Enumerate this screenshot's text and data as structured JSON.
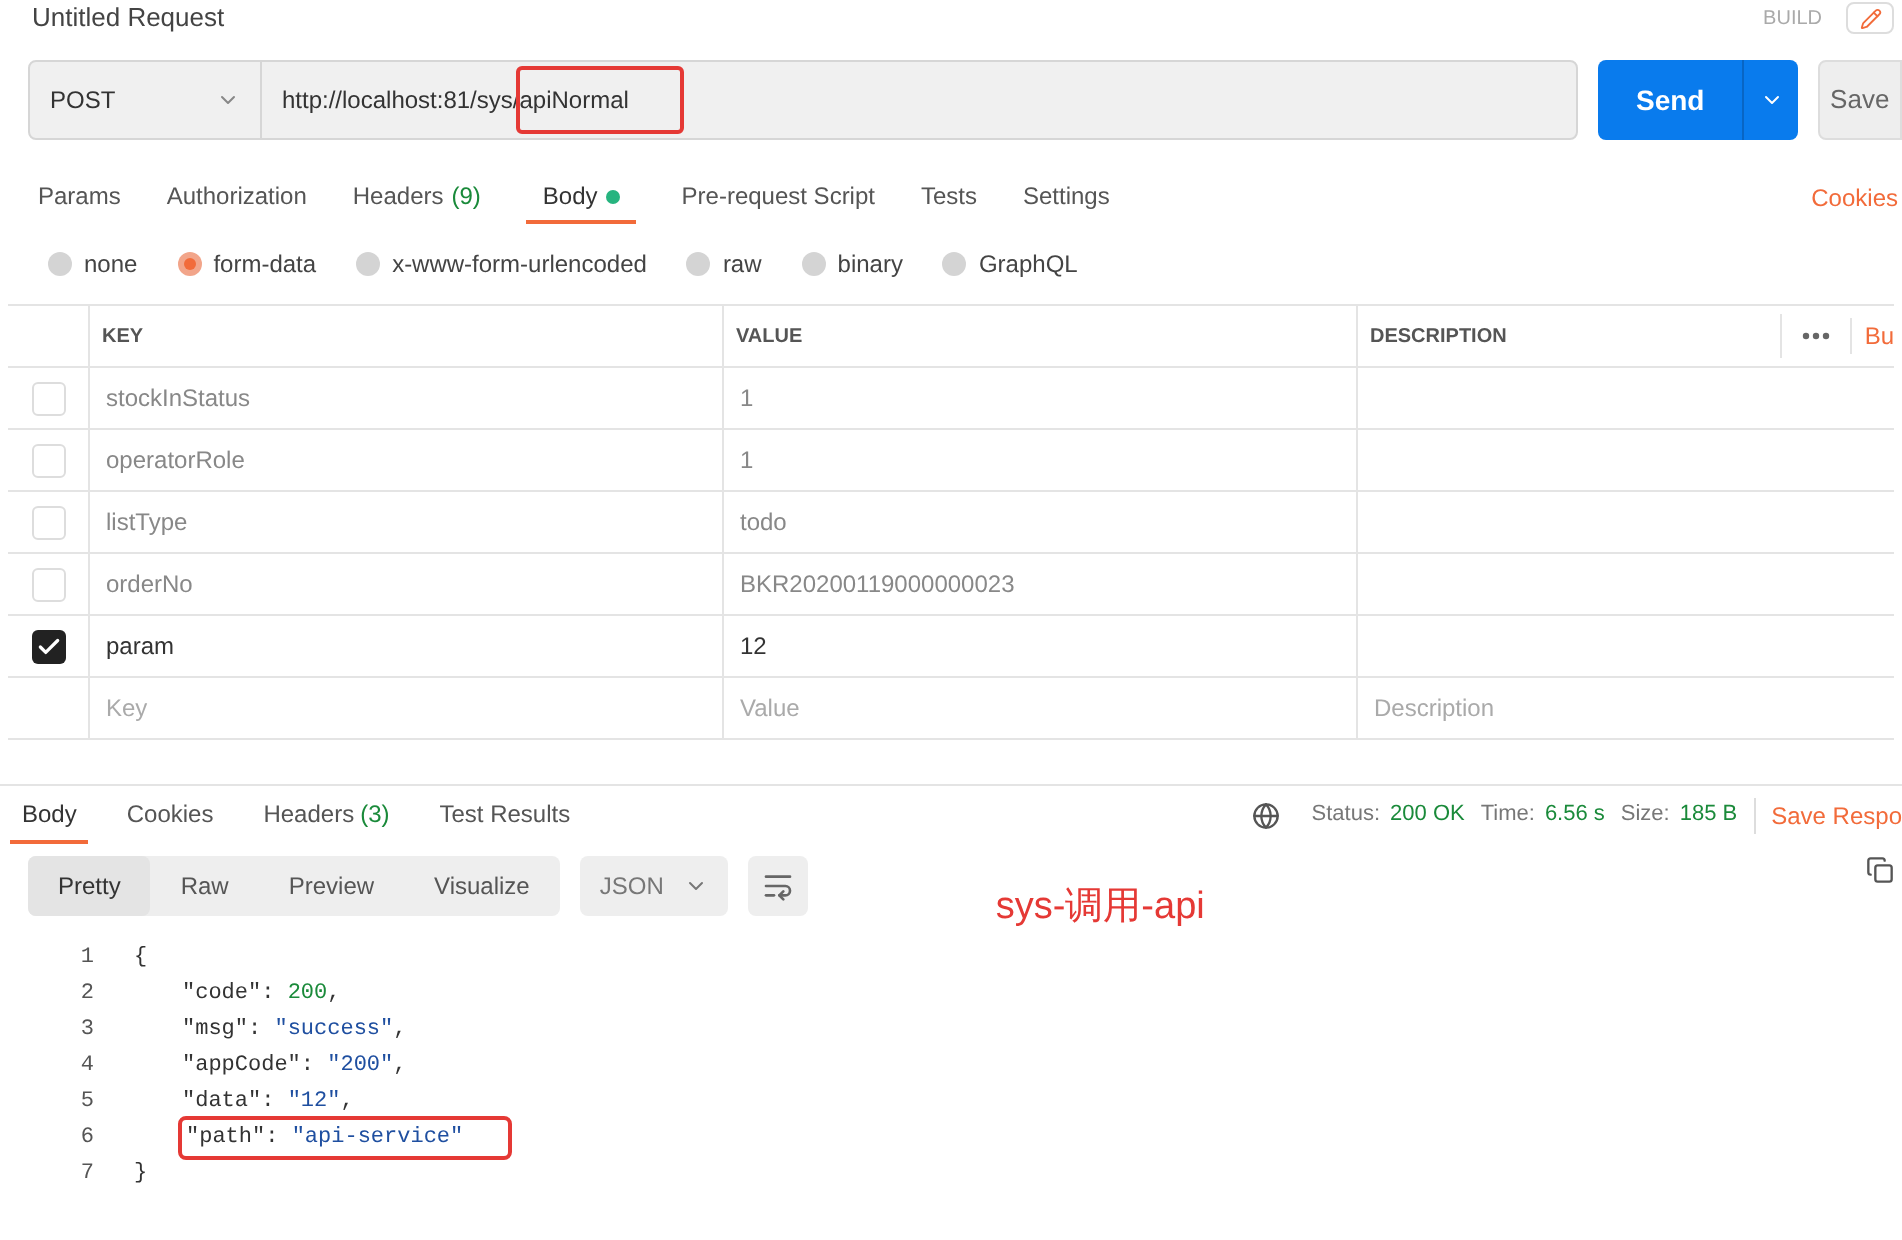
{
  "header": {
    "title": "Untitled Request",
    "build": "BUILD"
  },
  "request": {
    "method": "POST",
    "url_parts": [
      {
        "text": "http://localhost:81/sys/",
        "highlighted": false
      },
      {
        "text": "apiNormal",
        "highlighted": true
      }
    ],
    "send": "Send",
    "save": "Save"
  },
  "request_tabs": [
    {
      "label": "Params",
      "selected": false
    },
    {
      "label": "Authorization",
      "selected": false
    },
    {
      "label": "Headers",
      "count": "(9)",
      "selected": false
    },
    {
      "label": "Body",
      "selected": true,
      "dot": true
    },
    {
      "label": "Pre-request Script",
      "selected": false
    },
    {
      "label": "Tests",
      "selected": false
    },
    {
      "label": "Settings",
      "selected": false
    }
  ],
  "cookies_link": "Cookies",
  "body_types": [
    {
      "label": "none",
      "selected": false
    },
    {
      "label": "form-data",
      "selected": true
    },
    {
      "label": "x-www-form-urlencoded",
      "selected": false
    },
    {
      "label": "raw",
      "selected": false
    },
    {
      "label": "binary",
      "selected": false
    },
    {
      "label": "GraphQL",
      "selected": false
    }
  ],
  "table": {
    "columns": [
      "KEY",
      "VALUE",
      "DESCRIPTION"
    ],
    "bulk_edit": "Bu",
    "rows": [
      {
        "key": "stockInStatus",
        "value": "1",
        "checked": false
      },
      {
        "key": "operatorRole",
        "value": "1",
        "checked": false
      },
      {
        "key": "listType",
        "value": "todo",
        "checked": false
      },
      {
        "key": "orderNo",
        "value": "BKR20200119000000023",
        "checked": false
      },
      {
        "key": "param",
        "value": "12",
        "checked": true
      }
    ],
    "new_row": {
      "key": {
        "placeholder": "Key"
      },
      "value": {
        "placeholder": "Value"
      },
      "description": {
        "placeholder": "Description"
      }
    }
  },
  "response_tabs": [
    {
      "label": "Body",
      "selected": true
    },
    {
      "label": "Cookies",
      "selected": false
    },
    {
      "label": "Headers",
      "count": "(3)",
      "selected": false
    },
    {
      "label": "Test Results",
      "selected": false
    }
  ],
  "status": {
    "status_label": "Status:",
    "status": "200 OK",
    "time_label": "Time:",
    "time": "6.56 s",
    "size_label": "Size:",
    "size": "185 B",
    "save_response": "Save Respo"
  },
  "view_modes": [
    {
      "label": "Pretty",
      "selected": true
    },
    {
      "label": "Raw",
      "selected": false
    },
    {
      "label": "Preview",
      "selected": false
    },
    {
      "label": "Visualize",
      "selected": false
    }
  ],
  "format": "JSON",
  "annotation": "sys-调用-api",
  "code_lines": [
    {
      "number": "1",
      "highlighted": false,
      "tokens": [
        {
          "text": "{",
          "kind": "punct"
        }
      ]
    },
    {
      "number": "2",
      "highlighted": false,
      "tokens": [
        {
          "text": "\"code\"",
          "kind": "key"
        },
        {
          "text": ": ",
          "kind": "punct"
        },
        {
          "text": "200",
          "kind": "number"
        },
        {
          "text": ",",
          "kind": "punct"
        }
      ]
    },
    {
      "number": "3",
      "highlighted": false,
      "tokens": [
        {
          "text": "\"msg\"",
          "kind": "key"
        },
        {
          "text": ": ",
          "kind": "punct"
        },
        {
          "text": "\"success\"",
          "kind": "string"
        },
        {
          "text": ",",
          "kind": "punct"
        }
      ]
    },
    {
      "number": "4",
      "highlighted": false,
      "tokens": [
        {
          "text": "\"appCode\"",
          "kind": "key"
        },
        {
          "text": ": ",
          "kind": "punct"
        },
        {
          "text": "\"200\"",
          "kind": "string"
        },
        {
          "text": ",",
          "kind": "punct"
        }
      ]
    },
    {
      "number": "5",
      "highlighted": false,
      "tokens": [
        {
          "text": "\"data\"",
          "kind": "key"
        },
        {
          "text": ": ",
          "kind": "punct"
        },
        {
          "text": "\"12\"",
          "kind": "string"
        },
        {
          "text": ",",
          "kind": "punct"
        }
      ]
    },
    {
      "number": "6",
      "highlighted": true,
      "tokens": [
        {
          "text": "\"path\"",
          "kind": "key"
        },
        {
          "text": ": ",
          "kind": "punct"
        },
        {
          "text": "\"api-service\"",
          "kind": "string"
        }
      ]
    },
    {
      "number": "7",
      "highlighted": false,
      "tokens": [
        {
          "text": "}",
          "kind": "punct"
        }
      ]
    }
  ]
}
